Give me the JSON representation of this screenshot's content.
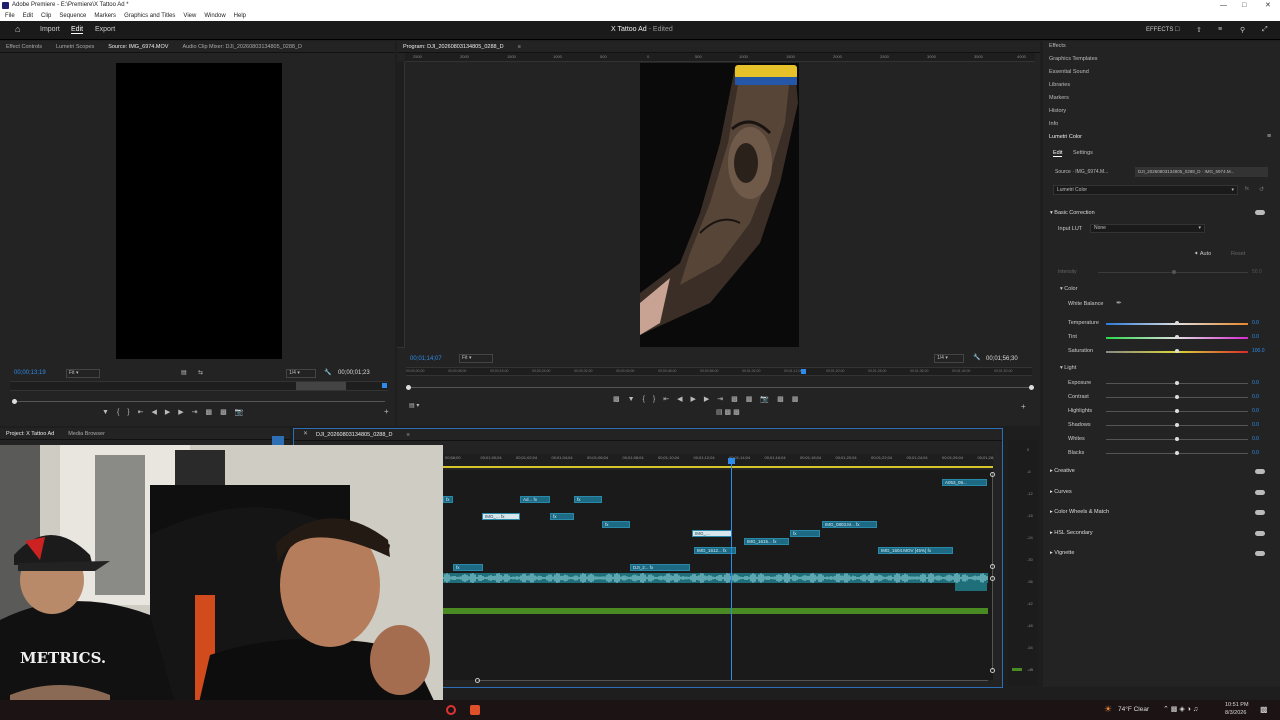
{
  "window": {
    "title": "Adobe Premiere - E:\\Premiere\\X Tattoo Ad *"
  },
  "menu": [
    "File",
    "Edit",
    "Clip",
    "Sequence",
    "Markers",
    "Graphics and Titles",
    "View",
    "Window",
    "Help"
  ],
  "appbar": {
    "home": "",
    "import": "Import",
    "edit": "Edit",
    "export": "Export",
    "project_title": "X Tattoo Ad",
    "edited": "- Edited",
    "effects_label": "EFFECTS"
  },
  "source_panel": {
    "tabs": [
      "Effect Controls",
      "Lumetri Scopes",
      "Source: IMG_6974.MOV",
      "Audio Clip Mixer: DJI_20260803134805_0288_D"
    ],
    "timecode": "00;00;13;19",
    "fit": "Fit",
    "resolution": "1/4",
    "duration": "00;00;01;23"
  },
  "program_panel": {
    "tab": "Program: DJI_20260803134805_0288_D",
    "ruler_ticks": [
      "2500",
      "2000",
      "1500",
      "1000",
      "500",
      "0",
      "500",
      "1000",
      "1500",
      "2000",
      "2500",
      "3000",
      "3500",
      "4000"
    ],
    "timecode": "00;01;14;07",
    "fit": "Fit",
    "resolution": "1/4",
    "duration": "00;01;56;30",
    "scrub_ticks": [
      "00;00;00;00",
      "00;00;08;00",
      "00;00;16;00",
      "00;00;24;00",
      "00;00;32;00",
      "00;00;40;00",
      "00;00;48;00",
      "00;00;56;00",
      "00;01;04;00",
      "00;01;12;00",
      "00;01;20;00",
      "00;01;28;00",
      "00;01;36;00",
      "00;01;44;00",
      "00;01;52;00"
    ]
  },
  "project_panel": {
    "tabs": [
      "Project: X Tattoo Ad",
      "Media Browser"
    ]
  },
  "timeline": {
    "tab": "DJI_20260803134805_0288_D",
    "ticks": [
      "00;58;00",
      "00;01;00;04",
      "00;01;02;04",
      "00;01;04;04",
      "00;01;06;04",
      "00;01;08;04",
      "00;01;10;04",
      "00;01;12;04",
      "00;01;14;04",
      "00;01;16;04",
      "00;01;18;04",
      "00;01;20;04",
      "00;01;22;04",
      "00;01;24;04",
      "00;01;26;04",
      "00;01;28;"
    ],
    "clips": [
      {
        "label": "fx",
        "track": "v6"
      },
      {
        "label": "Ad... fx",
        "track": "v6"
      },
      {
        "label": "fx",
        "track": "v6"
      },
      {
        "label": "A053_08...",
        "track": "v7"
      },
      {
        "label": "IMG_... fx",
        "track": "v5"
      },
      {
        "label": "fx",
        "track": "v5"
      },
      {
        "label": "fx",
        "track": "v4"
      },
      {
        "label": "IMG_0803.M... fx",
        "track": "v4"
      },
      {
        "label": "IMG_...",
        "track": "v3"
      },
      {
        "label": "fx",
        "track": "v3"
      },
      {
        "label": "IMG_1615... fx",
        "track": "v2"
      },
      {
        "label": "IMG_1612... fx",
        "track": "v1"
      },
      {
        "label": "IMG_1604.MOV [45%] fx",
        "track": "v1"
      },
      {
        "label": "fx",
        "track": "v0"
      },
      {
        "label": "DJI_2... fx",
        "track": "v0"
      }
    ],
    "meter_ticks": [
      "0",
      "-6",
      "-12",
      "-18",
      "-24",
      "-30",
      "-36",
      "-42",
      "-48",
      "-54",
      "-dB"
    ]
  },
  "right_panel": {
    "panels": [
      "Effects",
      "Graphics Templates",
      "Essential Sound",
      "Libraries",
      "Markers",
      "History",
      "Info"
    ],
    "lumetri_title": "Lumetri Color",
    "tabs": [
      "Edit",
      "Settings"
    ],
    "source_clip": "Source · IMG_6974.M...",
    "sequence_clip": "DJI_20260803134805_0288_D · IMG_6974.M...",
    "effect_select": "Lumetri Color",
    "basic_correction": "Basic Correction",
    "input_lut_label": "Input LUT",
    "input_lut_value": "None",
    "auto": "Auto",
    "reset": "Reset",
    "intensity": "Intensity",
    "intensity_val": "50.0",
    "color": "Color",
    "white_balance": "White Balance",
    "sliders": [
      {
        "name": "Temperature",
        "value": "0.0",
        "pos": 0.5
      },
      {
        "name": "Tint",
        "value": "0.0",
        "pos": 0.5
      },
      {
        "name": "Saturation",
        "value": "100.0",
        "pos": 0.5
      }
    ],
    "light": "Light",
    "light_sliders": [
      {
        "name": "Exposure",
        "value": "0.0",
        "pos": 0.5
      },
      {
        "name": "Contrast",
        "value": "0.0",
        "pos": 0.5
      },
      {
        "name": "Highlights",
        "value": "0.0",
        "pos": 0.5
      },
      {
        "name": "Shadows",
        "value": "0.0",
        "pos": 0.5
      },
      {
        "name": "Whites",
        "value": "0.0",
        "pos": 0.5
      },
      {
        "name": "Blacks",
        "value": "0.0",
        "pos": 0.5
      }
    ],
    "sections": [
      "Creative",
      "Curves",
      "Color Wheels & Match",
      "HSL Secondary",
      "Vignette"
    ]
  },
  "webcam": {
    "shirt_text": "METRICS."
  },
  "taskbar": {
    "weather": "74°F  Clear",
    "time": "10:51 PM",
    "date": "8/3/2026"
  },
  "colors": {
    "accent": "#2d8ceb",
    "clip": "#1d6a85",
    "audio": "#23838c",
    "green": "#5a9a2a"
  }
}
